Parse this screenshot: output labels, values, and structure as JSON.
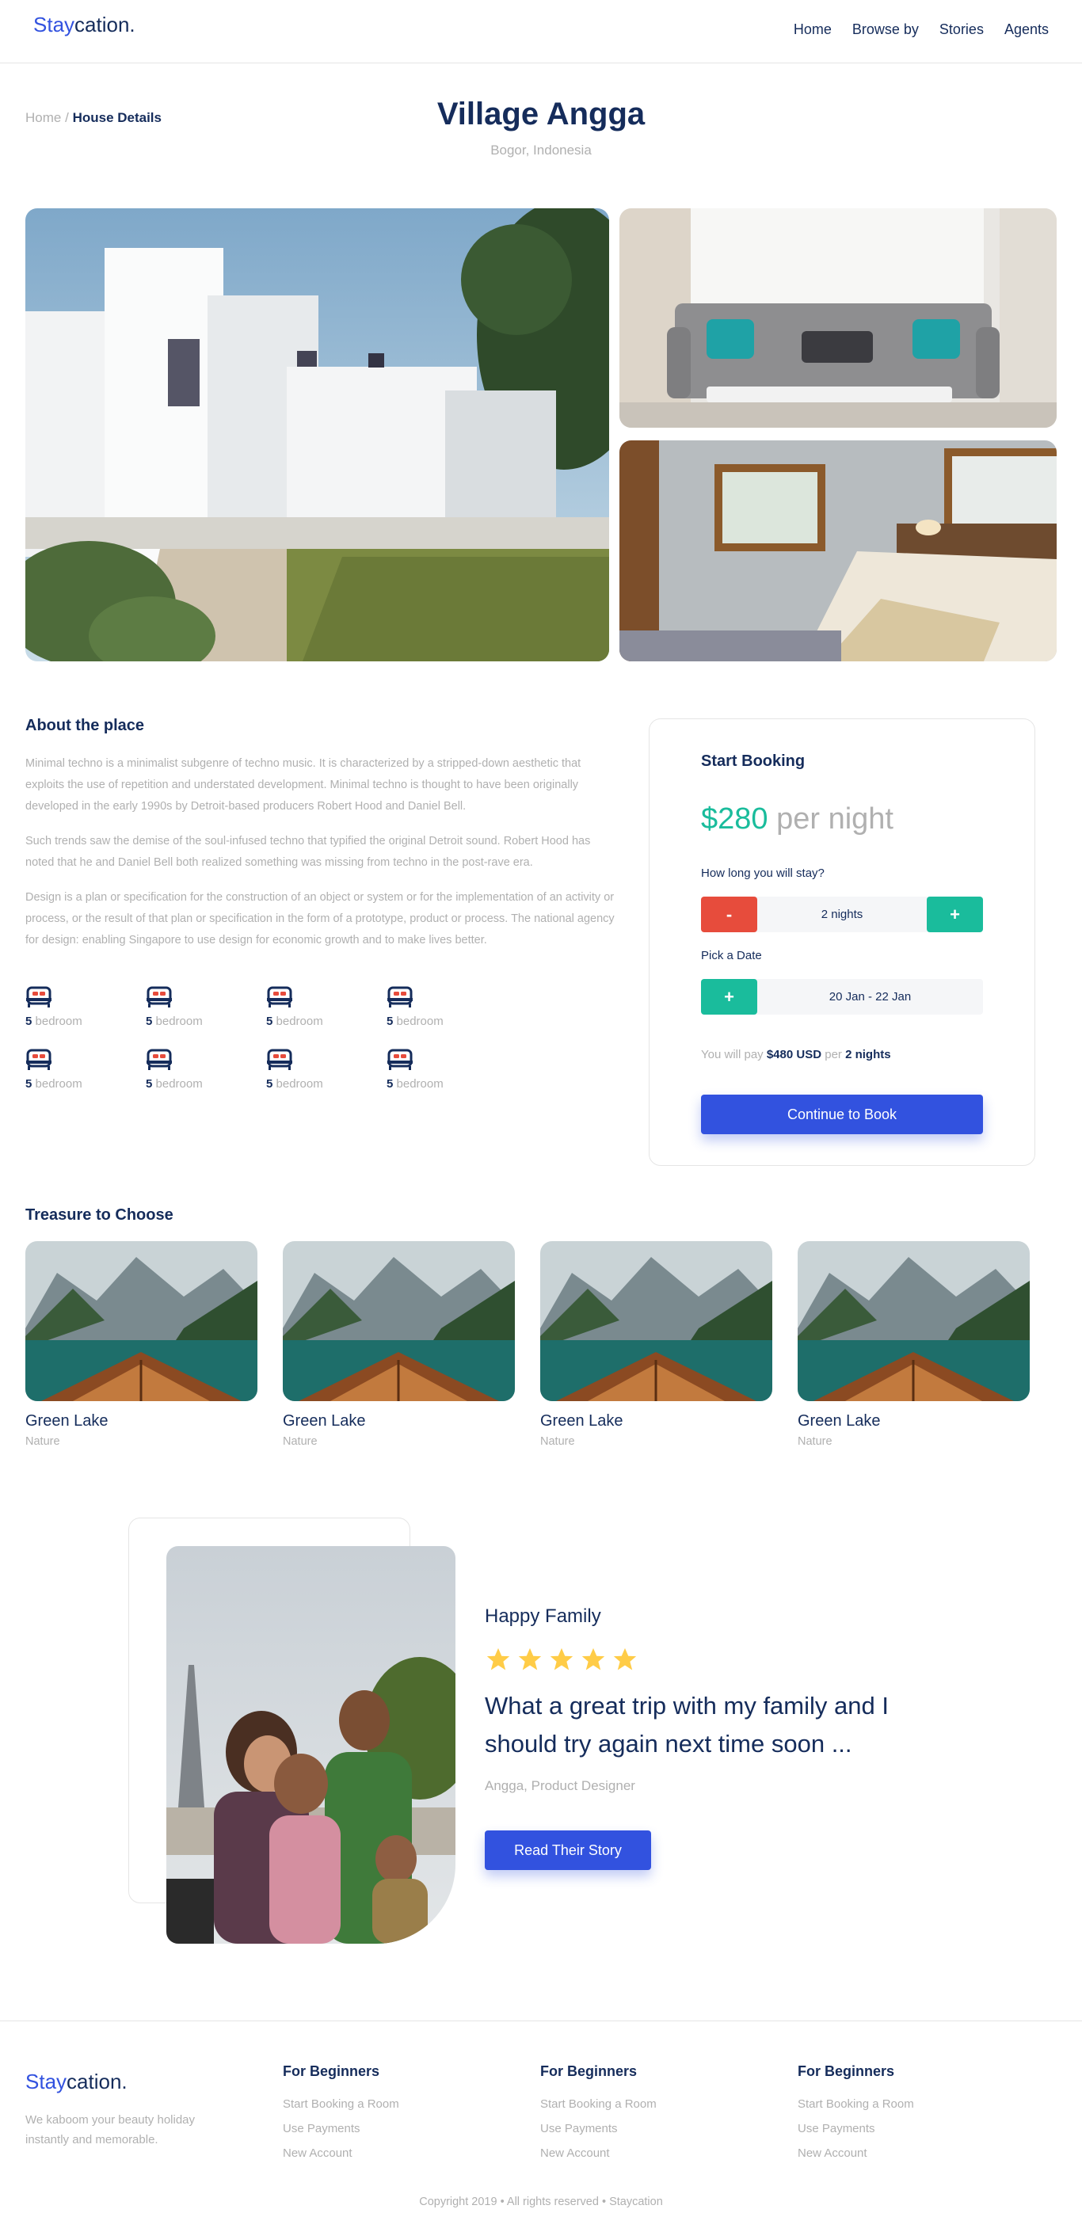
{
  "header": {
    "logo_a": "Stay",
    "logo_b": "cation.",
    "nav": [
      "Home",
      "Browse by",
      "Stories",
      "Agents"
    ]
  },
  "breadcrumb": {
    "home": "Home",
    "separator": "/",
    "current": "House Details"
  },
  "page": {
    "title": "Village Angga",
    "location": "Bogor, Indonesia"
  },
  "about": {
    "heading": "About the place",
    "paragraphs": [
      "Minimal techno is a minimalist subgenre of techno music. It is characterized by a stripped-down aesthetic that exploits the use of repetition and understated development. Minimal techno is thought to have been originally developed in the early 1990s by Detroit-based producers Robert Hood and Daniel Bell.",
      "Such trends saw the demise of the soul-infused techno that typified the original Detroit sound. Robert Hood has noted that he and Daniel Bell both realized something was missing from techno in the post-rave era.",
      "Design is a plan or specification for the construction of an object or system or for the implementation of an activity or process, or the result of that plan or specification in the form of a prototype, product or process. The national agency for design: enabling Singapore to use design for economic growth and to make lives better."
    ],
    "features": [
      {
        "count": "5",
        "label": "bedroom"
      },
      {
        "count": "5",
        "label": "bedroom"
      },
      {
        "count": "5",
        "label": "bedroom"
      },
      {
        "count": "5",
        "label": "bedroom"
      },
      {
        "count": "5",
        "label": "bedroom"
      },
      {
        "count": "5",
        "label": "bedroom"
      },
      {
        "count": "5",
        "label": "bedroom"
      },
      {
        "count": "5",
        "label": "bedroom"
      }
    ]
  },
  "booking": {
    "title": "Start Booking",
    "price": "$280",
    "per": "per night",
    "duration_label": "How long you will stay?",
    "minus": "-",
    "plus": "+",
    "duration_value": "2 nights",
    "date_label": "Pick a Date",
    "date_button": "+",
    "date_value": "20 Jan - 22 Jan",
    "pay_prefix": "You will pay",
    "pay_amount": "$480 USD",
    "pay_mid": "per",
    "pay_nights": "2 nights",
    "cta": "Continue to Book"
  },
  "treasure": {
    "heading": "Treasure to Choose",
    "items": [
      {
        "name": "Green Lake",
        "category": "Nature"
      },
      {
        "name": "Green Lake",
        "category": "Nature"
      },
      {
        "name": "Green Lake",
        "category": "Nature"
      },
      {
        "name": "Green Lake",
        "category": "Nature"
      }
    ]
  },
  "testimonial": {
    "title": "Happy Family",
    "rating": 5,
    "quote": "What a great trip with my family and I should try again next time soon ...",
    "author": "Angga, Product Designer",
    "button": "Read Their Story"
  },
  "footer": {
    "logo_a": "Stay",
    "logo_b": "cation.",
    "tagline": "We kaboom your beauty holiday instantly and memorable.",
    "columns": [
      {
        "heading": "For Beginners",
        "links": [
          "Start Booking a Room",
          "Use Payments",
          "New Account"
        ]
      },
      {
        "heading": "For Beginners",
        "links": [
          "Start Booking a Room",
          "Use Payments",
          "New Account"
        ]
      },
      {
        "heading": "For Beginners",
        "links": [
          "Start Booking a Room",
          "Use Payments",
          "New Account"
        ]
      }
    ],
    "copyright": "Copyright 2019 • All rights reserved • Staycation"
  },
  "colors": {
    "primary": "#3252DF",
    "navy": "#152C5B",
    "teal": "#1ABC9C",
    "red": "#E74C3C",
    "gray": "#B0B0B0",
    "star": "#FFCC47"
  },
  "icons": {
    "feature": "bed-icon",
    "rating": "star-icon"
  }
}
